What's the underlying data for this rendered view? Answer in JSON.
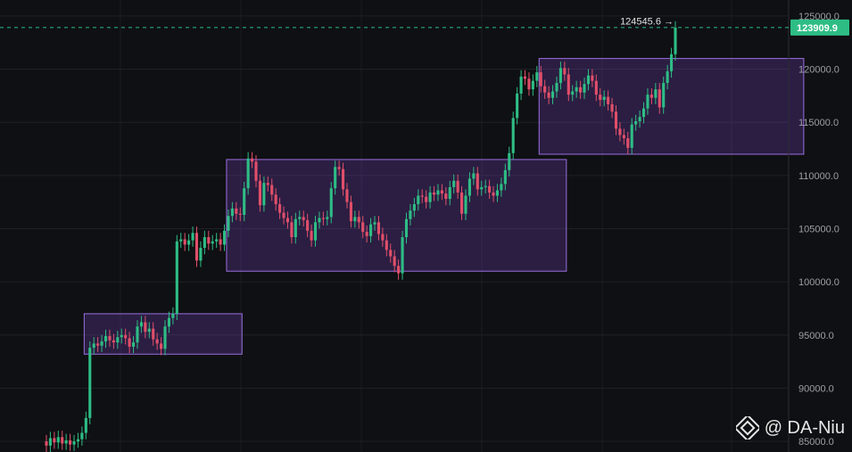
{
  "chart_data": {
    "type": "candlestick",
    "ylim": [
      84000,
      126500
    ],
    "y_ticks": [
      85000,
      90000,
      95000,
      100000,
      105000,
      110000,
      115000,
      120000,
      125000
    ],
    "y_tick_labels": [
      "85000.0",
      "90000.0",
      "95000.0",
      "100000.0",
      "105000.0",
      "110000.0",
      "115000.0",
      "120000.0",
      "125000.0"
    ],
    "current_price": 123909.9,
    "current_price_label": "123909.9",
    "high_marker": 124545.6,
    "high_marker_label": "124545.6 →",
    "range_boxes": [
      {
        "from_index": 10,
        "to_index": 49,
        "low": 93200,
        "high": 97000
      },
      {
        "from_index": 46,
        "to_index": 131,
        "low": 101000,
        "high": 111500
      },
      {
        "from_index": 125,
        "to_index": 191,
        "low": 112000,
        "high": 121000
      }
    ],
    "candles_close": [
      84600,
      85300,
      84900,
      85400,
      84800,
      85100,
      84700,
      85000,
      85200,
      85800,
      87200,
      93800,
      94200,
      94000,
      94400,
      94900,
      94500,
      94300,
      94800,
      95000,
      94700,
      93900,
      94300,
      95800,
      96200,
      95300,
      95600,
      94600,
      94200,
      93700,
      95800,
      96600,
      97000,
      103800,
      104000,
      103500,
      103900,
      104600,
      102000,
      103200,
      104200,
      103600,
      103800,
      104000,
      103500,
      104800,
      106200,
      106900,
      106400,
      106300,
      108800,
      111600,
      111300,
      109500,
      107200,
      109300,
      109100,
      108200,
      107300,
      106500,
      106000,
      105600,
      104200,
      105900,
      106100,
      105800,
      104800,
      103900,
      105600,
      106000,
      105900,
      106100,
      108800,
      110800,
      110600,
      108700,
      107500,
      105700,
      106100,
      105600,
      104700,
      104300,
      105400,
      105600,
      104500,
      103900,
      103000,
      102400,
      101500,
      100800,
      104200,
      105900,
      106700,
      107300,
      108100,
      108000,
      107500,
      108400,
      108200,
      108600,
      108300,
      107800,
      108900,
      109500,
      108400,
      106400,
      108100,
      109700,
      110200,
      108700,
      108900,
      109000,
      108400,
      108100,
      108600,
      109200,
      110500,
      112100,
      115400,
      117700,
      119300,
      119100,
      118100,
      118900,
      119700,
      118400,
      117800,
      117300,
      117900,
      118700,
      120100,
      119500,
      117600,
      117900,
      118300,
      117800,
      118600,
      119400,
      118900,
      117600,
      117100,
      117400,
      116700,
      116000,
      114400,
      113800,
      113500,
      112600,
      114800,
      115100,
      115500,
      116300,
      117600,
      117300,
      118100,
      116400,
      118700,
      119800,
      121400,
      123900
    ],
    "candles_open": [
      85000,
      84600,
      85300,
      84900,
      85400,
      84800,
      85100,
      84700,
      85000,
      85200,
      85800,
      87200,
      93800,
      94200,
      94000,
      94400,
      94900,
      94500,
      94300,
      94800,
      95000,
      94700,
      93900,
      94300,
      95800,
      96200,
      95300,
      95600,
      94600,
      94200,
      93700,
      95800,
      96600,
      97000,
      103800,
      104000,
      103500,
      103900,
      104600,
      102000,
      103200,
      104200,
      103600,
      103800,
      104000,
      103500,
      104800,
      106200,
      106900,
      106400,
      106300,
      108800,
      111600,
      111300,
      109500,
      107200,
      109300,
      109100,
      108200,
      107300,
      106500,
      106000,
      105600,
      104200,
      105900,
      106100,
      105800,
      104800,
      103900,
      105600,
      106000,
      105900,
      106100,
      108800,
      110800,
      110600,
      108700,
      107500,
      105700,
      106100,
      105600,
      104700,
      104300,
      105400,
      105600,
      104500,
      103900,
      103000,
      102400,
      101500,
      100800,
      104200,
      105900,
      106700,
      107300,
      108100,
      108000,
      107500,
      108400,
      108200,
      108600,
      108300,
      107800,
      108900,
      109500,
      108400,
      106400,
      108100,
      109700,
      110200,
      108700,
      108900,
      109000,
      108400,
      108100,
      108600,
      109200,
      110500,
      112100,
      115400,
      117700,
      119300,
      119100,
      118100,
      118900,
      119700,
      118400,
      117800,
      117300,
      117900,
      118700,
      120100,
      119500,
      117600,
      117900,
      118300,
      117800,
      118600,
      119400,
      118900,
      117600,
      117100,
      117400,
      116700,
      116000,
      114400,
      113800,
      113500,
      112600,
      114800,
      115100,
      115500,
      116300,
      117600,
      117300,
      118100,
      116400,
      118700,
      119800,
      121400
    ]
  }
}
